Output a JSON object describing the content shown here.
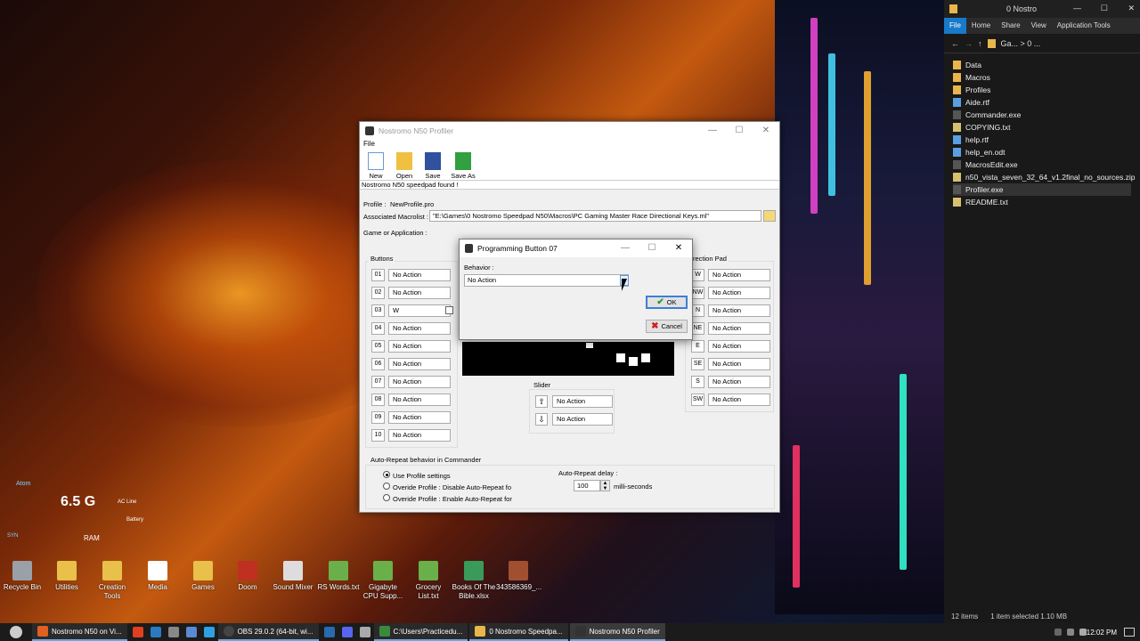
{
  "desktop": {
    "icons": [
      {
        "label": "Recycle Bin",
        "color": "#9aa0a8"
      },
      {
        "label": "Utilities",
        "color": "#e8c04a"
      },
      {
        "label": "Creation Tools",
        "color": "#e8c04a"
      },
      {
        "label": "Media",
        "color": "#ffffff"
      },
      {
        "label": "Games",
        "color": "#e8c04a"
      },
      {
        "label": "Doom",
        "color": "#c03020"
      },
      {
        "label": "Sound Mixer",
        "color": "#dddddd"
      },
      {
        "label": "RS Words.txt",
        "color": "#6ab04a"
      },
      {
        "label": "Gigabyte CPU Supp...",
        "color": "#6ab04a"
      },
      {
        "label": "Grocery List.txt",
        "color": "#6ab04a"
      },
      {
        "label": "Books Of The Bible.xlsx",
        "color": "#3a9a5a"
      },
      {
        "label": "343586369_...",
        "color": "#a05030"
      }
    ],
    "widget": {
      "title": "Atom",
      "ram_value": "6.5 G",
      "ram_label": "RAM",
      "power": "AC Line",
      "battery": "Battery",
      "brand": "SYN"
    }
  },
  "explorer": {
    "title": "0 Nostro",
    "tabs": [
      "File",
      "Home",
      "Share",
      "View",
      "Application Tools"
    ],
    "address": "Ga...  >  0 ...",
    "items": [
      {
        "name": "Data",
        "type": "folder"
      },
      {
        "name": "Macros",
        "type": "folder"
      },
      {
        "name": "Profiles",
        "type": "folder"
      },
      {
        "name": "Aide.rtf",
        "type": "doc"
      },
      {
        "name": "Commander.exe",
        "type": "exe"
      },
      {
        "name": "COPYING.txt",
        "type": "txt"
      },
      {
        "name": "help.rtf",
        "type": "doc"
      },
      {
        "name": "help_en.odt",
        "type": "doc"
      },
      {
        "name": "MacrosEdit.exe",
        "type": "exe"
      },
      {
        "name": "n50_vista_seven_32_64_v1.2final_no_sources.zip",
        "type": "txt"
      },
      {
        "name": "Profiler.exe",
        "type": "exe",
        "selected": true
      },
      {
        "name": "README.txt",
        "type": "txt"
      }
    ],
    "status_count": "12 items",
    "status_selected": "1 item selected  1.10 MB"
  },
  "main_window": {
    "title": "Nostromo N50 Profiler",
    "menu": "File",
    "toolbar": [
      "New",
      "Open",
      "Save",
      "Save As"
    ],
    "status": "Nostromo N50 speedpad found !",
    "profile_label": "Profile :",
    "profile_value": "NewProfile.pro",
    "macrolist_label": "Associated Macrolist :",
    "macrolist_value": "\"E:\\Games\\0 Nostromo Speedpad N50\\Macros\\PC Gaming Master Race Directional Keys.ml\"",
    "game_label": "Game or Application :",
    "buttons_label": "Buttons",
    "buttons": [
      {
        "num": "01",
        "action": "No Action"
      },
      {
        "num": "02",
        "action": "No Action"
      },
      {
        "num": "03",
        "action": "W"
      },
      {
        "num": "04",
        "action": "No Action"
      },
      {
        "num": "05",
        "action": "No Action"
      },
      {
        "num": "06",
        "action": "No Action"
      },
      {
        "num": "07",
        "action": "No Action"
      },
      {
        "num": "08",
        "action": "No Action"
      },
      {
        "num": "09",
        "action": "No Action"
      },
      {
        "num": "10",
        "action": "No Action"
      }
    ],
    "dpad_label": "rection Pad",
    "dpad": [
      {
        "dir": "W",
        "action": "No Action"
      },
      {
        "dir": "NW",
        "action": "No Action"
      },
      {
        "dir": "N",
        "action": "No Action"
      },
      {
        "dir": "NE",
        "action": "No Action"
      },
      {
        "dir": "E",
        "action": "No Action"
      },
      {
        "dir": "SE",
        "action": "No Action"
      },
      {
        "dir": "S",
        "action": "No Action"
      },
      {
        "dir": "SW",
        "action": "No Action"
      }
    ],
    "slider_label": "Slider",
    "slider": [
      {
        "arrow": "⇧",
        "action": "No Action"
      },
      {
        "arrow": "⇩",
        "action": "No Action"
      }
    ],
    "autorepeat_label": "Auto-Repeat behavior in Commander",
    "radios": [
      {
        "label": "Use Profile settings",
        "checked": true
      },
      {
        "label": "Overide Profile : Disable Auto-Repeat fo",
        "checked": false
      },
      {
        "label": "Overide Profile : Enable Auto-Repeat for",
        "checked": false
      }
    ],
    "delay_label": "Auto-Repeat delay :",
    "delay_value": "100",
    "delay_unit": "milli-seconds"
  },
  "dialog": {
    "title": "Programming Button 07",
    "behavior_label": "Behavior :",
    "behavior_value": "No Action",
    "ok": "OK",
    "cancel": "Cancel"
  },
  "taskbar": {
    "apps": [
      "Nostromo N50 on Vi...",
      "OBS 29.0.2 (64-bit, wi...",
      "C:\\Users\\Practicedu...",
      "0 Nostromo Speedpa...",
      "Nostromo N50 Profiler"
    ],
    "time": "12:02 PM"
  }
}
